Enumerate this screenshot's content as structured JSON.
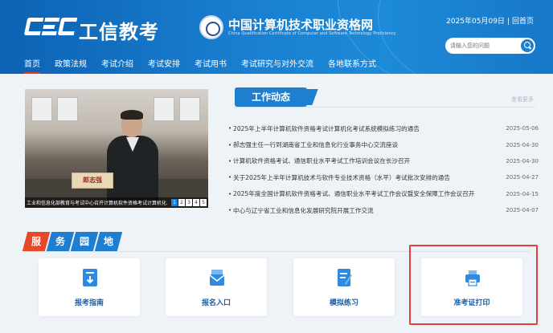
{
  "header": {
    "brand": "工信教考",
    "site_title": "中国计算机技术职业资格网",
    "site_subtitle": "China Qualification Certificate of Computer and Software Technology Proficiency",
    "date": "2025年05月09日",
    "home_link": "回首页",
    "search_placeholder": "请输入您的问题"
  },
  "nav": [
    {
      "label": "首页",
      "active": true
    },
    {
      "label": "政策法规"
    },
    {
      "label": "考试介绍"
    },
    {
      "label": "考试安排"
    },
    {
      "label": "考试用书"
    },
    {
      "label": "考试研究与对外交流"
    },
    {
      "label": "各地联系方式"
    }
  ],
  "slideshow": {
    "caption": "工业和信息化部教育与考试中心召开计算机软件资格考试计算机化...",
    "nameplate": "郎志强",
    "pages": [
      "1",
      "2",
      "3",
      "4",
      "5"
    ]
  },
  "news": {
    "tab_label": "工作动态",
    "more_label": "查看更多",
    "items": [
      {
        "title": "2025年上半年计算机软件资格考试计算机化考试系统模拟练习的通告",
        "date": "2025-05-06"
      },
      {
        "title": "郝志强主任一行到湖南省工业和信息化行业事务中心交流座谈",
        "date": "2025-04-30"
      },
      {
        "title": "计算机软件资格考试、通信职业水平考试工作培训会议在长沙召开",
        "date": "2025-04-30"
      },
      {
        "title": "关于2025年上半年计算机技术与软件专业技术资格（水平）考试批次安排的通告",
        "date": "2025-04-27"
      },
      {
        "title": "2025年度全国计算机软件资格考试、通信职业水平考试工作会议暨安全保障工作会议召开",
        "date": "2025-04-15"
      },
      {
        "title": "中心与辽宁省工业和信息化发展研究院开展工作交流",
        "date": "2025-04-07"
      }
    ]
  },
  "services": {
    "title_chars": [
      "服",
      "务",
      "园",
      "地"
    ],
    "cards": [
      {
        "label": "报考指南",
        "icon": "guide-icon"
      },
      {
        "label": "报名入口",
        "icon": "signup-icon"
      },
      {
        "label": "模拟练习",
        "icon": "practice-icon"
      },
      {
        "label": "准考证打印",
        "icon": "printer-icon"
      }
    ]
  },
  "colors": {
    "primary": "#1e7fd0",
    "accent": "#e8472a",
    "highlight": "#e0413b"
  }
}
